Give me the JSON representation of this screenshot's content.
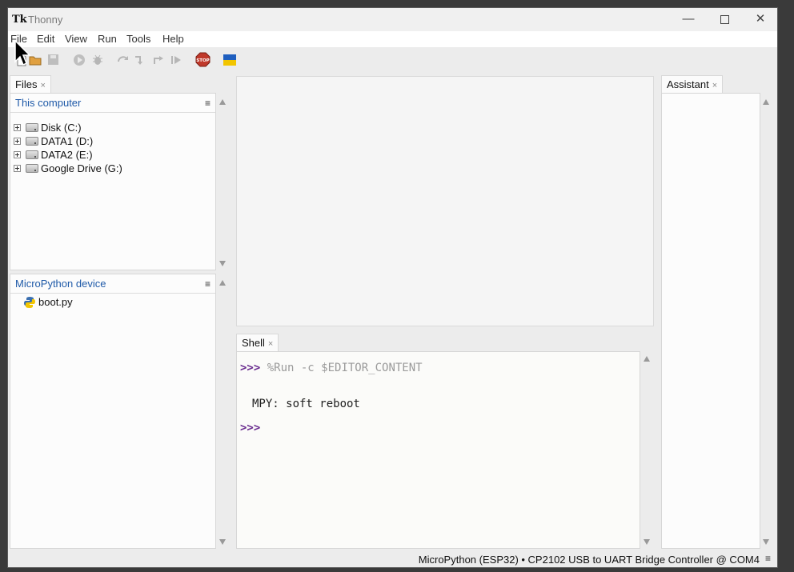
{
  "window": {
    "app_icon": "Tk",
    "title": "Thonny",
    "min_glyph": "—",
    "close_glyph": "✕"
  },
  "menu": {
    "items": [
      "File",
      "Edit",
      "View",
      "Run",
      "Tools",
      "Help"
    ]
  },
  "toolbar": {
    "icons": [
      "new-file-icon",
      "open-file-icon",
      "save-icon",
      "run-icon",
      "debug-icon",
      "step-over-icon",
      "step-into-icon",
      "step-out-icon",
      "resume-icon",
      "stop-icon",
      "ukraine-flag-icon"
    ],
    "stop_label": "STOP"
  },
  "files_tab": {
    "label": "Files",
    "close": "×"
  },
  "this_computer": {
    "header": "This computer",
    "menu_glyph": "≡",
    "drives": [
      "Disk (C:)",
      "DATA1 (D:)",
      "DATA2 (E:)",
      "Google Drive (G:)"
    ]
  },
  "micropython_device": {
    "header": "MicroPython device",
    "menu_glyph": "≡",
    "files": [
      "boot.py"
    ]
  },
  "shell": {
    "tab_label": "Shell",
    "close": "×",
    "prompt": ">>>",
    "command": "%Run -c $EDITOR_CONTENT",
    "output": "MPY: soft reboot",
    "prompt2": ">>>"
  },
  "assistant_tab": {
    "label": "Assistant",
    "close": "×"
  },
  "status": {
    "interpreter": "MicroPython (ESP32)  •  CP2102 USB to UART Bridge Controller @ COM4",
    "menu_glyph": "≡"
  },
  "colors": {
    "prompt": "#6a2d8f",
    "link_header": "#1f5aa8",
    "stop": "#c0392b",
    "flag_blue": "#1f5fbf",
    "flag_yellow": "#f2c500"
  }
}
